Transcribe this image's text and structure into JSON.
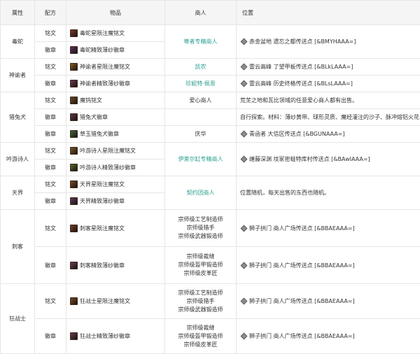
{
  "headers": {
    "attribute": "属性",
    "formula": "配方",
    "item": "物品",
    "vendor": "商人",
    "location": "位置"
  },
  "groups": [
    {
      "attribute": "毒蛇",
      "rows": [
        {
          "formula": "铭文",
          "item": "毒蛇星陨注魔铭文",
          "icon_color": "#7a3a34"
        },
        {
          "formula": "徽章",
          "item": "毒蛇精致薄纱徽章",
          "icon_color": "#5e2f66"
        }
      ],
      "vendor_groups": [
        {
          "lines": [
            "尊者专精商人"
          ],
          "link": true,
          "location": "赤金盆地 遗忘之都传送点 [&BMYHAAA=]",
          "waypoint": true
        }
      ]
    },
    {
      "attribute": "神谕者",
      "rows": [
        {
          "formula": "铭文",
          "item": "神谕者星陨注魔铭文",
          "icon_color": "#8a5a2a"
        },
        {
          "formula": "徽章",
          "item": "神谕者精致薄纱徽章",
          "icon_color": "#6a3a58"
        }
      ],
      "vendor_groups": [
        {
          "lines": [
            "凯农"
          ],
          "link": true,
          "location": "雷云高峰 了望甲板传送点 [&BLkLAAA=]",
          "waypoint": true
        },
        {
          "lines": [
            "珍妮特·佩恩"
          ],
          "link": true,
          "location": "雷云高峰 历史终格传送点 [&BLsLAAA=]",
          "waypoint": true
        }
      ]
    },
    {
      "attribute": "猎兔犬",
      "rows": [
        {
          "formula": "铭文",
          "item": "魔钨铭文",
          "icon_color": "#6b4a2a"
        },
        {
          "formula": "徽章",
          "item": "猎兔犬徽章",
          "icon_color": "#5a3a4e"
        },
        {
          "formula": "徽章",
          "item": "草玉猎兔犬徽章",
          "icon_color": "#3f6a3a"
        }
      ],
      "vendor_groups": [
        {
          "lines": [
            "爱心商人"
          ],
          "link": false,
          "location": "荒芜之地和瓦比领域的任意爱心商人都有出售。",
          "waypoint": false
        },
        {
          "lines": [
            ""
          ],
          "link": false,
          "location": "自行探索。材料：薄纱黄带、球形灵质、魔经灌注的沙子、脉冲熔铝火花",
          "waypoint": false
        },
        {
          "lines": [
            "庆华"
          ],
          "link": false,
          "location": "青函者 大信区传送点 [&BGUNAAA=]",
          "waypoint": true
        }
      ]
    },
    {
      "attribute": "吟游诗人",
      "rows": [
        {
          "formula": "铭文",
          "item": "吟游诗人星陨注魔铭文",
          "icon_color": "#7a5a2a"
        },
        {
          "formula": "徽章",
          "item": "吟游诗人精致薄纱徽章",
          "icon_color": "#5a6a2a"
        }
      ],
      "vendor_groups": [
        {
          "lines": [
            "伊莱尔缸专精商人"
          ],
          "link": true,
          "location": "缠藤深渊 坟冢密蛙特库村传送点 [&BAwIAAA=]",
          "waypoint": true
        }
      ]
    },
    {
      "attribute": "天界",
      "rows": [
        {
          "formula": "铭文",
          "item": "天界星陨注魔铭文",
          "icon_color": "#7a4a2a"
        },
        {
          "formula": "徽章",
          "item": "天界精致薄纱徽章",
          "icon_color": "#5e3a66"
        }
      ],
      "vendor_groups": [
        {
          "lines": [
            "契约团商人"
          ],
          "link": true,
          "location": "位置随机，每天出售的东西也随机。",
          "waypoint": false
        }
      ]
    },
    {
      "attribute": "刺客",
      "rows": [
        {
          "formula": "铭文",
          "item": "刺客星陨注魔铭文",
          "icon_color": "#7a3a2a"
        },
        {
          "formula": "徽章",
          "item": "刺客精致薄纱徽章",
          "icon_color": "#6a3a5a"
        }
      ],
      "vendor_groups": [
        {
          "lines": [
            "宗师级工艺制造师",
            "宗师级猎手",
            "宗师级武器锻造师"
          ],
          "link": false,
          "location": "狮子拱门 商人广场传送点 [&BBAEAAA=]",
          "waypoint": true
        },
        {
          "lines": [
            "宗师级裁缝",
            "宗师级盔甲锻造师",
            "宗师级皮革匠"
          ],
          "link": false,
          "location": "狮子拱门 商人广场传送点 [&BBAEAAA=]",
          "waypoint": true
        }
      ]
    },
    {
      "attribute": "狂战士",
      "rows": [
        {
          "formula": "铭文",
          "item": "狂战士星陨注魔铭文",
          "icon_color": "#7a4a24"
        },
        {
          "formula": "徽章",
          "item": "狂战士精致薄纱徽章",
          "icon_color": "#6a3a52"
        }
      ],
      "vendor_groups": [
        {
          "lines": [
            "宗师级工艺制造师",
            "宗师级猎手",
            "宗师级武器锻造师"
          ],
          "link": false,
          "location": "狮子拱门 商人广场传送点 [&BBAEAAA=]",
          "waypoint": true
        },
        {
          "lines": [
            "宗师级裁缝",
            "宗师级盔甲锻造师",
            "宗师级皮革匠"
          ],
          "link": false,
          "location": "狮子拱门 商人广场传送点 [&BBAEAAA=]",
          "waypoint": true
        }
      ]
    }
  ]
}
